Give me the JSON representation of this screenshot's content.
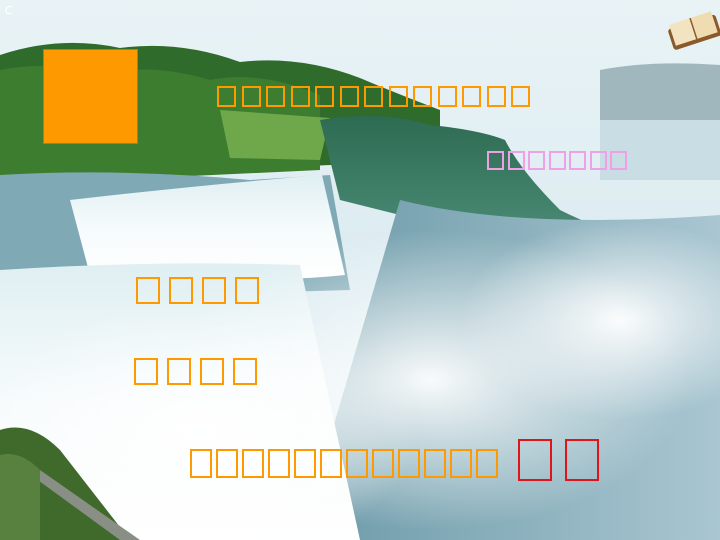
{
  "slide": {
    "corner_mark": "C",
    "title": "□□□□□□□□□□□□□",
    "subtitle": "□□□□□□□",
    "line_a": "□□□□",
    "line_b": "□□□□",
    "line_c": "□□□□□□□□□□□□",
    "line_c_emphasis": "□□"
  },
  "colors": {
    "orange": "#ff9900",
    "pink": "#f0a0e6",
    "red": "#e0141a"
  },
  "icons": {
    "corner": "open-book-icon"
  }
}
